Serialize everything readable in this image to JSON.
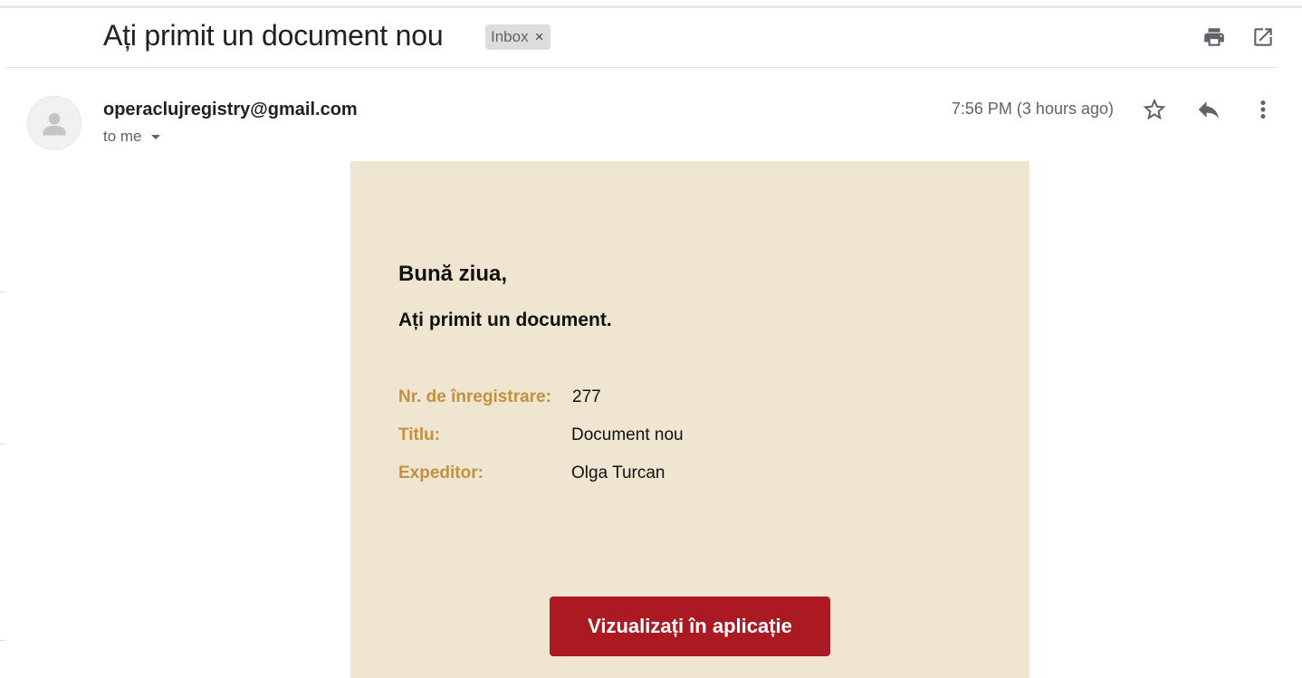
{
  "email": {
    "subject": "Ați primit un document nou",
    "label": {
      "name": "Inbox",
      "remove_glyph": "×"
    },
    "sender": "operaclujregistry@gmail.com",
    "recipient_label": "to me",
    "timestamp": "7:56 PM (3 hours ago)"
  },
  "toolbar_icons": [
    "print-icon",
    "open-in-new-window-icon"
  ],
  "message_actions_icons": [
    "star-icon",
    "reply-icon",
    "more-vert-icon"
  ],
  "body": {
    "greeting": "Bună ziua,",
    "intro": "Ați primit un document.",
    "details": [
      {
        "key": "Nr. de înregistrare:",
        "value": "277"
      },
      {
        "key": "Titlu:",
        "value": "Document nou"
      },
      {
        "key": "Expeditor:",
        "value": "Olga Turcan"
      }
    ],
    "button_label": "Vizualizați în aplicație"
  },
  "colors": {
    "card_background": "#efe5d0",
    "detail_key": "#c39040",
    "button_background": "#ab1a22",
    "label_chip_background": "#dddddd"
  }
}
